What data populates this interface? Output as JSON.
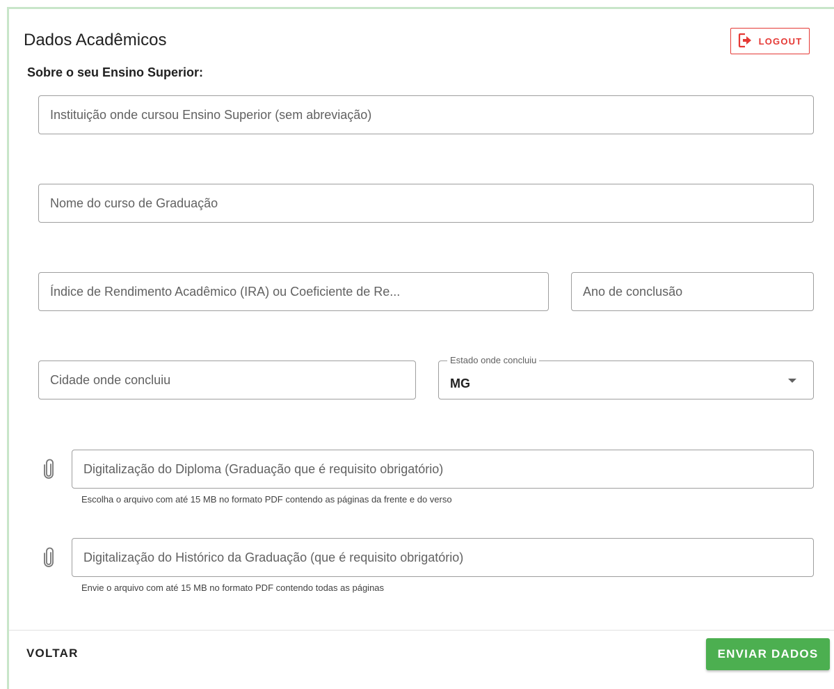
{
  "header": {
    "title": "Dados Acadêmicos",
    "subtitle": "Sobre o seu Ensino Superior:",
    "logout_label": "LOGOUT"
  },
  "fields": {
    "instituicao": {
      "placeholder": "Instituição onde cursou Ensino Superior (sem abreviação)"
    },
    "curso": {
      "placeholder": "Nome do curso de Graduação"
    },
    "ira": {
      "placeholder": "Índice de Rendimento Acadêmico (IRA) ou Coeficiente de Re..."
    },
    "ano": {
      "placeholder": "Ano de conclusão"
    },
    "cidade": {
      "placeholder": "Cidade onde concluiu"
    },
    "estado": {
      "label": "Estado onde concluiu",
      "value": "MG"
    },
    "diploma": {
      "placeholder": "Digitalização do Diploma (Graduação que é requisito obrigatório)",
      "hint": "Escolha o arquivo com até 15 MB no formato PDF contendo as páginas da frente e do verso"
    },
    "historico": {
      "placeholder": "Digitalização do Histórico da Graduação (que é requisito obrigatório)",
      "hint": "Envie o arquivo com até 15 MB no formato PDF contendo todas as páginas"
    }
  },
  "footer": {
    "back_label": "VOLTAR",
    "submit_label": "ENVIAR DADOS"
  },
  "colors": {
    "accent_green": "#4caf50",
    "logout_red": "#e53935",
    "card_border": "#c8e6c9"
  },
  "icons": {
    "logout": "logout-icon",
    "attachment": "paperclip-icon",
    "dropdown": "caret-down-icon"
  }
}
